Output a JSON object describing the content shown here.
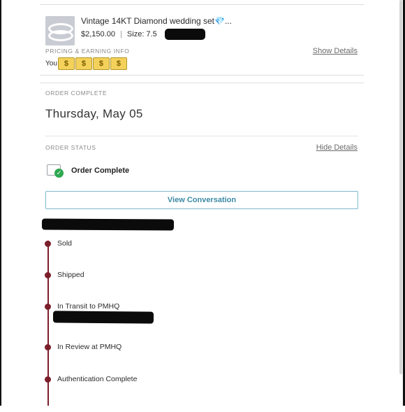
{
  "item": {
    "title": "Vintage 14KT Diamond wedding set💎...",
    "price": "$2,150.00",
    "size_label": "Size: 7.5"
  },
  "pricing": {
    "section_label": "PRICING & EARNING INFO",
    "show_details": "Show Details",
    "earning_prefix": "You",
    "money_glyph": "$"
  },
  "order_complete": {
    "section_label": "ORDER COMPLETE",
    "date": "Thursday, May 05"
  },
  "order_status": {
    "section_label": "ORDER STATUS",
    "hide_details": "Hide Details",
    "status": "Order Complete",
    "status_icon": "package-check-icon",
    "status_color": "#2fa84f"
  },
  "conversation": {
    "button_label": "View Conversation",
    "accent": "#3c8aa6"
  },
  "timeline": {
    "color": "#7b1e2b",
    "steps": [
      {
        "label": "Sold"
      },
      {
        "label": "Shipped"
      },
      {
        "label": "In Transit to PMHQ"
      },
      {
        "label": "In Review at PMHQ"
      },
      {
        "label": "Authentication Complete"
      }
    ]
  }
}
